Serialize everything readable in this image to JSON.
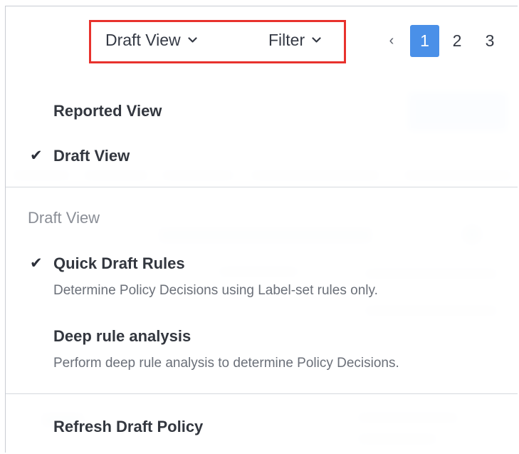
{
  "toolbar": {
    "view_label": "Draft View",
    "filter_label": "Filter"
  },
  "pagination": {
    "prev_symbol": "‹",
    "pages": [
      "1",
      "2",
      "3"
    ],
    "active_page": "1"
  },
  "menu": {
    "view_options": [
      {
        "label": "Reported View",
        "checked": false
      },
      {
        "label": "Draft View",
        "checked": true
      }
    ],
    "section_label": "Draft View",
    "draft_options": [
      {
        "label": "Quick Draft Rules",
        "description": "Determine Policy Decisions using Label-set rules only.",
        "checked": true
      },
      {
        "label": "Deep rule analysis",
        "description": "Perform deep rule analysis to determine Policy Decisions.",
        "checked": false
      }
    ],
    "refresh_label": "Refresh Draft Policy",
    "check_glyph": "✔"
  },
  "colors": {
    "accent": "#4a90e8",
    "highlight": "#e8322d"
  }
}
